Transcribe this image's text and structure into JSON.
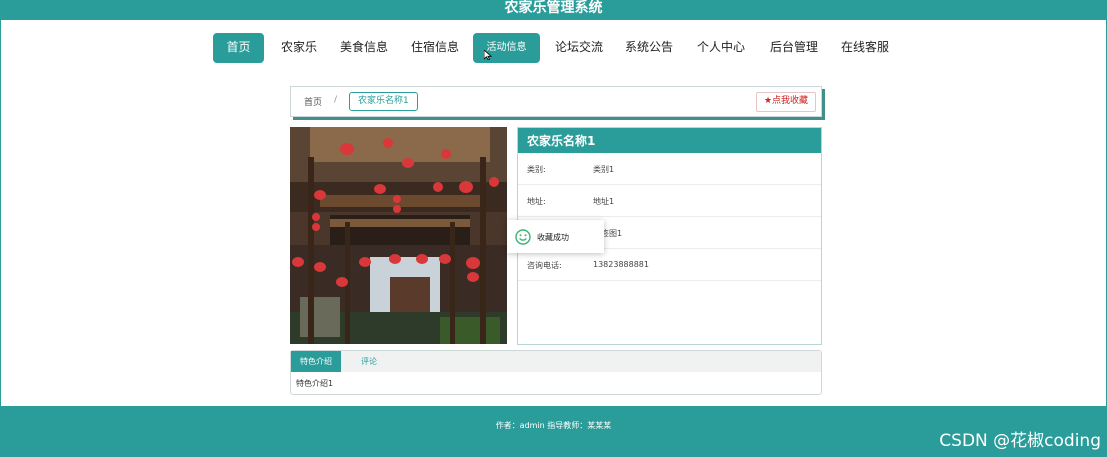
{
  "header": {
    "title": "农家乐管理系统"
  },
  "nav": {
    "items": [
      {
        "label": "首页",
        "state": "active"
      },
      {
        "label": "农家乐"
      },
      {
        "label": "美食信息"
      },
      {
        "label": "住宿信息"
      },
      {
        "label": "活动信息",
        "state": "hover"
      },
      {
        "label": "论坛交流"
      },
      {
        "label": "系统公告"
      },
      {
        "label": "个人中心"
      },
      {
        "label": "后台管理"
      },
      {
        "label": "在线客服"
      }
    ]
  },
  "breadcrumb": {
    "home": "首页",
    "separator": "/",
    "current": "农家乐名称1"
  },
  "favorite_button": {
    "label": "点我收藏",
    "icon": "star-icon"
  },
  "detail": {
    "title": "农家乐名称1",
    "rows": [
      {
        "label": "类别:",
        "value": "类别1"
      },
      {
        "label": "地址:",
        "value": "地址1"
      },
      {
        "label": "",
        "value": "标签图1"
      },
      {
        "label": "咨询电话:",
        "value": "13823888881"
      }
    ]
  },
  "toast": {
    "message": "收藏成功",
    "icon": "smile-icon"
  },
  "tabs": {
    "items": [
      {
        "label": "特色介绍"
      },
      {
        "label": "评论"
      }
    ],
    "content": "特色介绍1"
  },
  "footer": {
    "text": "作者：admin 指导教师：某某某"
  },
  "watermark": "CSDN @花椒coding",
  "colors": {
    "primary": "#2a9d9a",
    "favorite": "#d02020"
  }
}
